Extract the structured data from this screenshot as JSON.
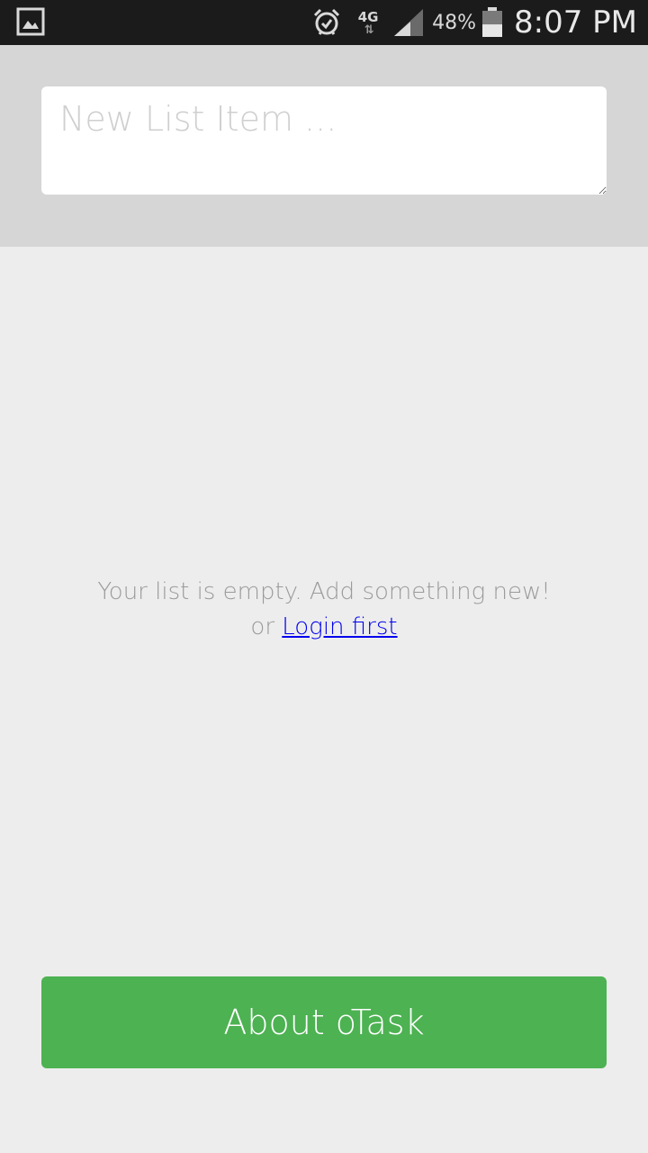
{
  "status_bar": {
    "left_icon": "gallery-icon",
    "alarm_icon": "alarm-clock-icon",
    "network_type": "4G",
    "network_arrows": "⇅",
    "signal_icon": "cell-signal-icon",
    "battery_percent": "48%",
    "battery_level": 0.48,
    "battery_icon": "battery-icon",
    "time": "8:07 PM"
  },
  "new_item": {
    "placeholder": "New List Item ...",
    "value": ""
  },
  "empty_state": {
    "message": "Your list is empty. Add something new!",
    "or_text": "or",
    "login_link": "Login first"
  },
  "about_button": {
    "label": "About oTask"
  },
  "colors": {
    "status_bar_bg": "#1b1b1b",
    "top_panel_bg": "#d6d6d6",
    "page_bg": "#ededed",
    "accent_green": "#4db252",
    "link": "#0000ee",
    "muted_text": "#9b9b9b"
  }
}
